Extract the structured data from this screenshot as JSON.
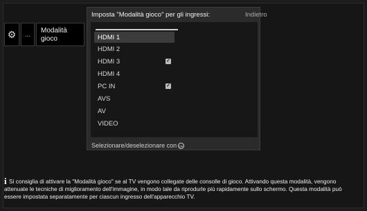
{
  "menu": {
    "gear_icon": "gear-icon",
    "more_label": "...",
    "mode_label": "Modalità gioco"
  },
  "panel": {
    "title": "Imposta \"Modalità gioco\" per gli ingressi:",
    "back_label": "Indietro",
    "items": [
      {
        "label": "HDMI 1",
        "checked": false,
        "selected": true
      },
      {
        "label": "HDMI 2",
        "checked": false,
        "selected": false
      },
      {
        "label": "HDMI 3",
        "checked": true,
        "selected": false
      },
      {
        "label": "HDMI 4",
        "checked": false,
        "selected": false
      },
      {
        "label": "PC IN",
        "checked": true,
        "selected": false
      },
      {
        "label": "AVS",
        "checked": false,
        "selected": false
      },
      {
        "label": "AV",
        "checked": false,
        "selected": false
      },
      {
        "label": "VIDEO",
        "checked": false,
        "selected": false
      }
    ],
    "footer_label": "Selezionare/deselezionare con",
    "footer_icon_text": "OK"
  },
  "info": {
    "icon": "info-icon",
    "text": "Si consiglia di attivare la \"Modalità gioco\" se al TV vengono collegate delle consolle di gioco. Attivando questa modalità, vengono attenuate le tecniche di miglioramento dell'immagine, in modo tale da riprodurle più rapidamente sullo schermo. Questa modalità può essere impostata separatamente per ciascun ingresso dell'apparecchio TV."
  },
  "colors": {
    "background": "#1c1c1c",
    "panel": "#2b2b2b",
    "list_bg": "#171717",
    "selected": "#3c3c3c"
  }
}
